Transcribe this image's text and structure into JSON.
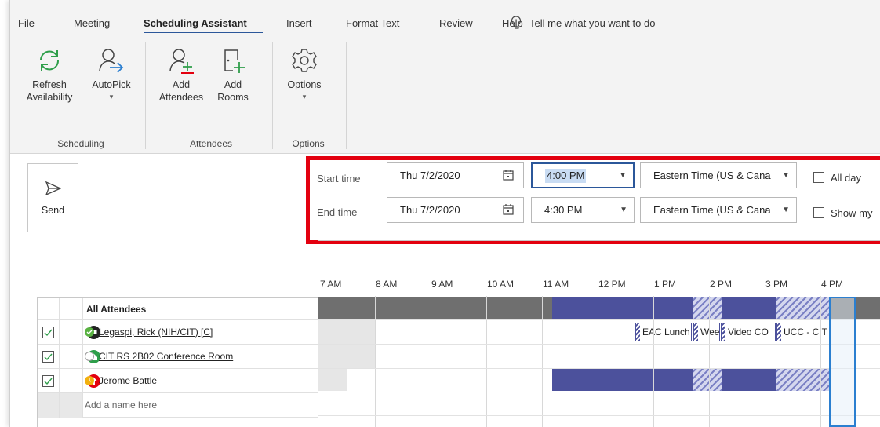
{
  "menu": {
    "items": [
      "File",
      "Meeting",
      "Scheduling Assistant",
      "Insert",
      "Format Text",
      "Review",
      "Help"
    ],
    "active": "Scheduling Assistant",
    "tell_me": "Tell me what you want to do"
  },
  "ribbon": {
    "refresh_line1": "Refresh",
    "refresh_line2": "Availability",
    "autopick": "AutoPick",
    "add_attendees_line1": "Add",
    "add_attendees_line2": "Attendees",
    "add_rooms_line1": "Add",
    "add_rooms_line2": "Rooms",
    "options": "Options",
    "group_scheduling": "Scheduling",
    "group_attendees": "Attendees",
    "group_options": "Options"
  },
  "send": {
    "label": "Send"
  },
  "time_fields": {
    "start_label": "Start time",
    "end_label": "End time",
    "start_date": "Thu 7/2/2020",
    "start_time": "4:00 PM",
    "start_tz": "Eastern Time (US & Cana",
    "end_date": "Thu 7/2/2020",
    "end_time": "4:30 PM",
    "end_tz": "Eastern Time (US & Cana",
    "all_day": "All day",
    "show_my": "Show my"
  },
  "timeline": {
    "hours": [
      "7 AM",
      "8 AM",
      "9 AM",
      "10 AM",
      "11 AM",
      "12 PM",
      "1 PM",
      "2 PM",
      "3 PM",
      "4 PM"
    ]
  },
  "attendees": {
    "header": "All Attendees",
    "rows": [
      {
        "name": "Legaspi, Rick (NIH/CIT) [C]",
        "status": "available"
      },
      {
        "name": "CIT RS 2B02 Conference Room",
        "status": "unknown"
      },
      {
        "name": "Jerome Battle",
        "status": "away"
      }
    ],
    "placeholder": "Add a name here"
  },
  "appointments": [
    "EAC Lunch",
    "Wee",
    "Video CO",
    "UCC - CIT"
  ],
  "colors": {
    "busy": "#4c519c",
    "highlight": "#e3000f",
    "accent": "#2b579a"
  }
}
